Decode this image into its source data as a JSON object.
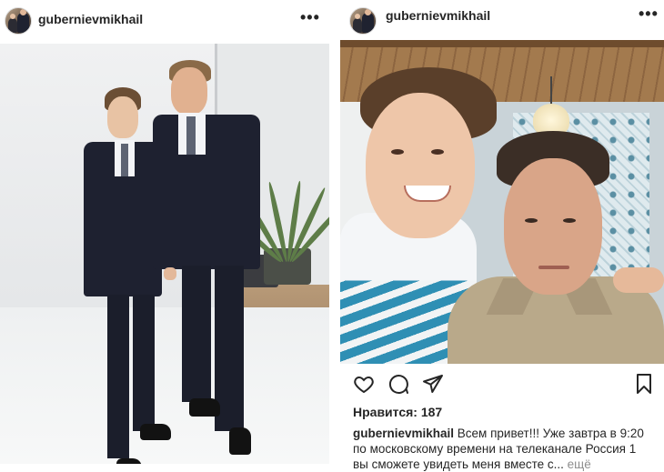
{
  "posts": [
    {
      "username": "gubernievmikhail",
      "more_label": "•••",
      "avatar_icon": "user-avatar-icon",
      "photo_icon": "post-photo"
    },
    {
      "username": "gubernievmikhail",
      "more_label": "•••",
      "avatar_icon": "user-avatar-icon",
      "photo_icon": "post-photo",
      "actions": {
        "like_icon": "heart-icon",
        "comment_icon": "comment-icon",
        "share_icon": "share-icon",
        "save_icon": "bookmark-icon"
      },
      "likes_text": "Нравится: 187",
      "caption": {
        "user": "gubernievmikhail",
        "line1": " Всем привет!!! Уже завтра в 9:20",
        "line2": "по московскому времени на телеканале Россия 1",
        "line3": "вы сможете увидеть меня вместе с...",
        "more": " ещё"
      }
    }
  ],
  "colors": {
    "text": "#262626",
    "muted": "#8e8e8e",
    "border": "#dbdbdb"
  }
}
